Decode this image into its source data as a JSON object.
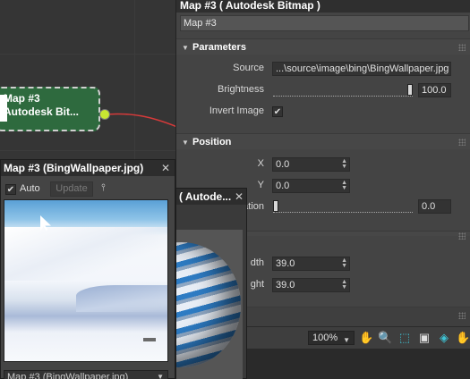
{
  "node": {
    "title": "Map #3",
    "subtitle": "Autodesk Bit..."
  },
  "panel": {
    "title": "Map #3  ( Autodesk Bitmap )",
    "name_value": "Map #3",
    "parameters": {
      "header": "Parameters",
      "source_label": "Source",
      "source_value": "...\\source\\image\\bing\\BingWallpaper.jpg",
      "brightness_label": "Brightness",
      "brightness_value": "100.0",
      "brightness_fraction": 1.0,
      "invert_label": "Invert Image",
      "invert_checked": true
    },
    "position": {
      "header": "Position",
      "x_label": "X",
      "x_value": "0.0",
      "y_label": "Y",
      "y_value": "0.0",
      "rotation_label": "ation",
      "rotation_value": "0.0",
      "width_label": "dth",
      "width_value": "39.0",
      "height_label": "ght",
      "height_value": "39.0"
    }
  },
  "toolbar": {
    "zoom": "100%"
  },
  "sphere_window": {
    "title": "( Autode..."
  },
  "viewer": {
    "title": "Map #3 (BingWallpaper.jpg)",
    "auto_label": "Auto",
    "auto_checked": true,
    "update_label": "Update",
    "dropdown_value": "Map #3 (BingWallpaper.jpg)"
  },
  "colors": {
    "node_green": "#2e6a3e",
    "port_yellow": "#c8e632",
    "wire_red": "#d63a3a"
  }
}
